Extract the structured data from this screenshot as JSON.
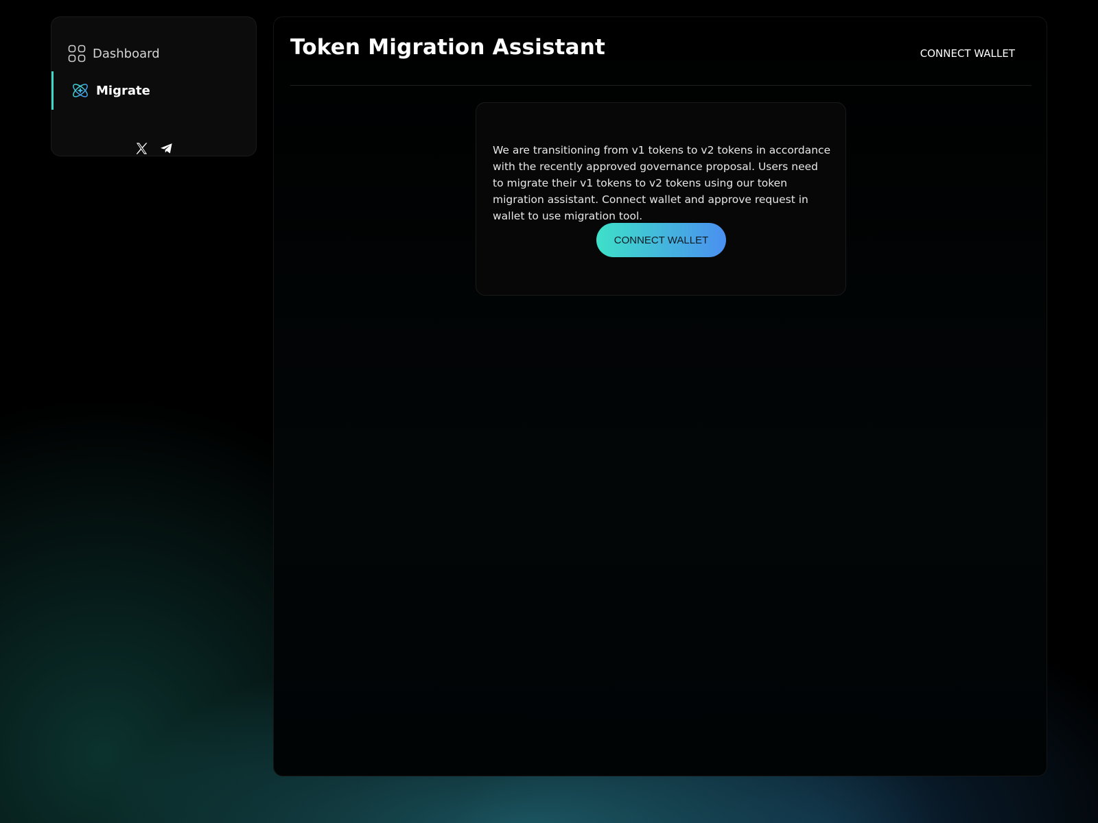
{
  "sidebar": {
    "items": [
      {
        "label": "Dashboard",
        "icon": "grid-icon",
        "active": false
      },
      {
        "label": "Migrate",
        "icon": "atom-icon",
        "active": true
      }
    ],
    "socials": [
      {
        "icon": "x-twitter-icon"
      },
      {
        "icon": "telegram-icon"
      }
    ]
  },
  "header": {
    "title": "Token Migration Assistant",
    "connect_label": "CONNECT WALLET"
  },
  "card": {
    "description": "We are transitioning from v1 tokens to v2 tokens in accordance with the recently approved governance proposal. Users need to migrate their v1 tokens to v2 tokens using our token migration assistant. Connect wallet and approve request in wallet to use migration tool.",
    "button_label": "CONNECT WALLET"
  },
  "colors": {
    "accent_active": "#3fd9c4",
    "button_gradient_start": "#3ee0c8",
    "button_gradient_end": "#4a8ff0"
  }
}
